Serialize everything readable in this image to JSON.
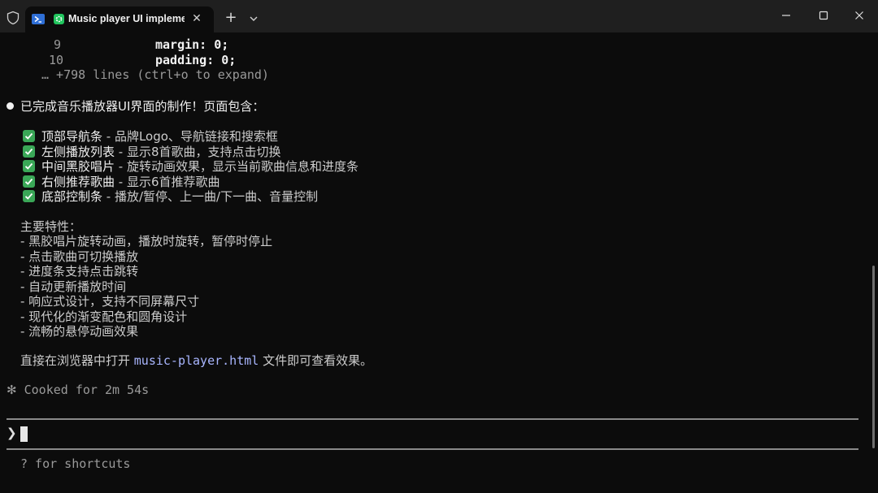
{
  "window": {
    "tab_title": "Music player UI implemen",
    "tab_close_glyph": "✕",
    "new_tab_glyph": "+"
  },
  "terminal": {
    "code_lines": [
      {
        "num": "9",
        "text": "margin: 0;"
      },
      {
        "num": "10",
        "text": "padding: 0;"
      }
    ],
    "collapsed_note": "… +798 lines (ctrl+o to expand)",
    "summary": "已完成音乐播放器UI界面的制作！页面包含：",
    "checklist": [
      {
        "title": "顶部导航条",
        "desc": " - 品牌Logo、导航链接和搜索框"
      },
      {
        "title": "左侧播放列表",
        "desc": " - 显示8首歌曲，支持点击切换"
      },
      {
        "title": "中间黑胶唱片",
        "desc": " - 旋转动画效果，显示当前歌曲信息和进度条"
      },
      {
        "title": "右侧推荐歌曲",
        "desc": " - 显示6首推荐歌曲"
      },
      {
        "title": "底部控制条",
        "desc": " - 播放/暂停、上一曲/下一曲、音量控制"
      }
    ],
    "features_heading": "主要特性：",
    "features": [
      "- 黑胶唱片旋转动画，播放时旋转，暂停时停止",
      "- 点击歌曲可切换播放",
      "- 进度条支持点击跳转",
      "- 自动更新播放时间",
      "- 响应式设计，支持不同屏幕尺寸",
      "- 现代化的渐变配色和圆角设计",
      "- 流畅的悬停动画效果"
    ],
    "open_prefix": "直接在浏览器中打开 ",
    "open_file": "music-player.html",
    "open_suffix": " 文件即可查看效果。",
    "cooked_star": "✻",
    "cooked_text": "Cooked for 2m 54s",
    "prompt_glyph": "❯",
    "shortcuts_hint": "? for shortcuts"
  },
  "colors": {
    "background": "#0c0c0c",
    "titlebar": "#1f1f1f",
    "check": "#3aa757",
    "file_link": "#a9b6ff",
    "app_icon": "#22c55e",
    "powershell_icon": "#2f6fd6"
  }
}
